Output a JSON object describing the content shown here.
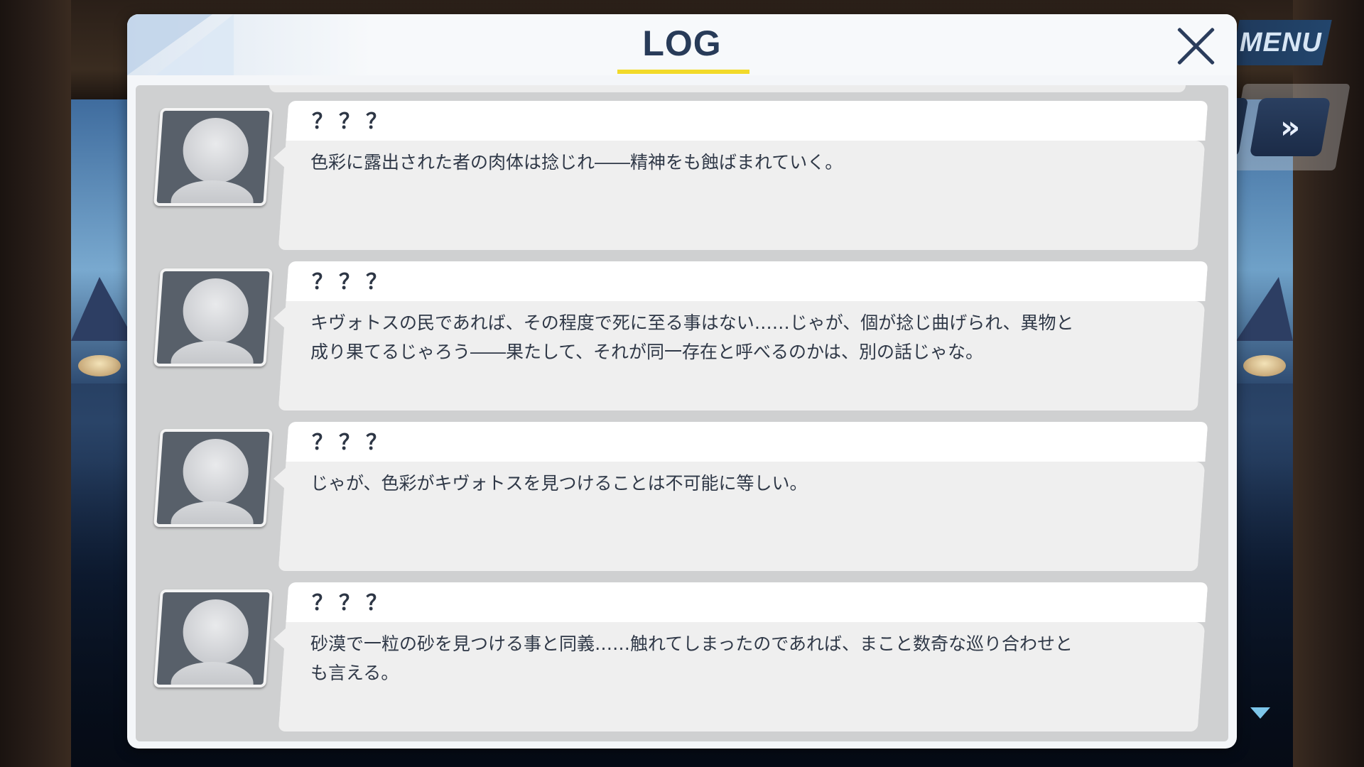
{
  "ui": {
    "menu_label": "MENU",
    "skip_label": "»"
  },
  "log": {
    "title": "LOG",
    "entries": [
      {
        "speaker": "？？？",
        "text": "色彩に露出された者の肉体は捻じれ――精神をも蝕ばまれていく。"
      },
      {
        "speaker": "？？？",
        "text": "キヴォトスの民であれば、その程度で死に至る事はない……じゃが、個が捻じ曲げられ、異物と成り果てるじゃろう――果たして、それが同一存在と呼べるのかは、別の話じゃな。"
      },
      {
        "speaker": "？？？",
        "text": "じゃが、色彩がキヴォトスを見つけることは不可能に等しい。"
      },
      {
        "speaker": "？？？",
        "text": "砂漠で一粒の砂を見つける事と同義……触れてしまったのであれば、まこと数奇な巡り合わせとも言える。"
      }
    ]
  },
  "icons": {
    "close": "close-icon",
    "skip": "fast-forward-icon",
    "avatar": "silhouette-avatar-icon",
    "scroll": "scroll-down-arrow-icon"
  },
  "colors": {
    "title_underline": "#f2da2a",
    "header_text": "#283b58",
    "menu_bg": "#22456c",
    "avatar_bg": "#58606a"
  }
}
